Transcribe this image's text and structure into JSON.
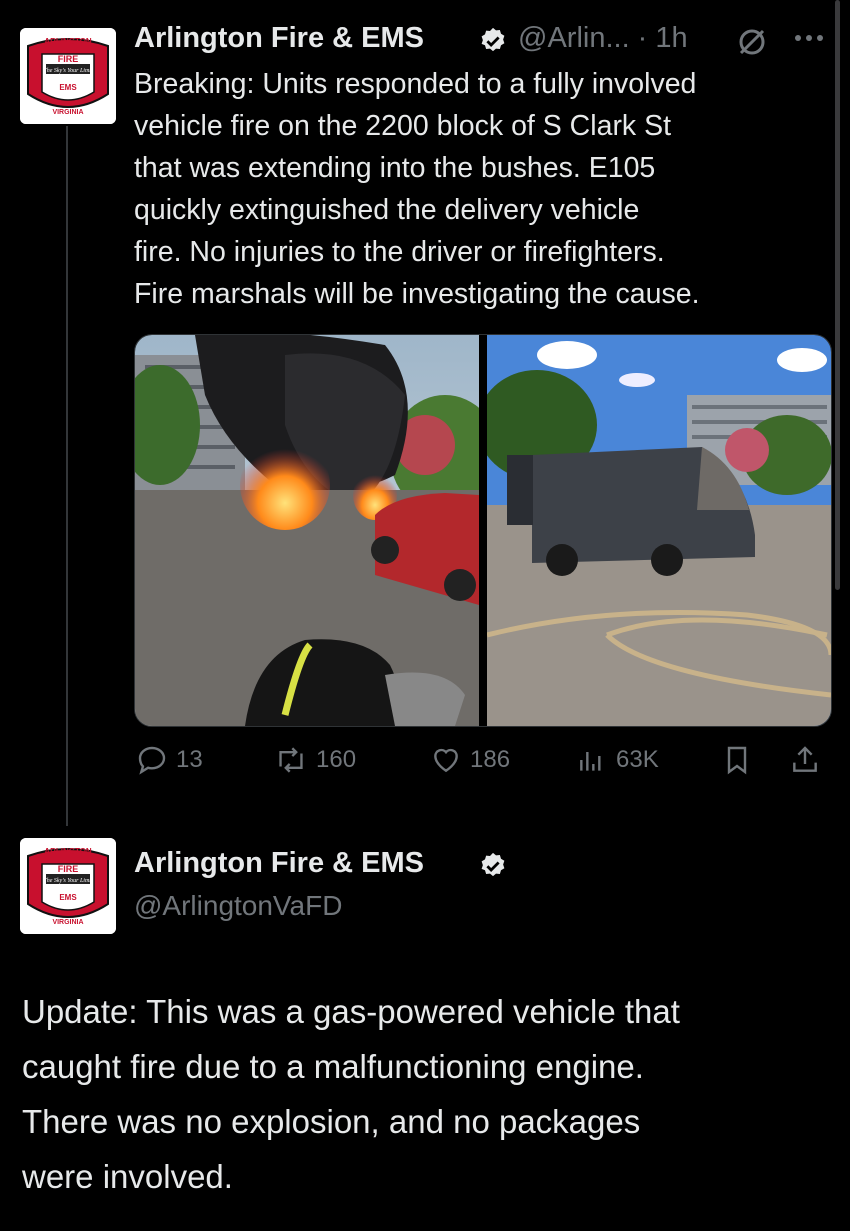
{
  "tweet1": {
    "author": "Arlington Fire & EMS",
    "handle_time": "@Arlin... · 1h",
    "text_lines": [
      "Breaking: Units responded to a fully involved",
      "vehicle fire on the 2200 block of S Clark St",
      "that was extending into the bushes. E105",
      "quickly extinguished the delivery vehicle",
      "fire. No injuries to the driver or firefighters.",
      "Fire marshals will be investigating the cause."
    ],
    "stats": {
      "replies": "13",
      "reposts": "160",
      "likes": "186",
      "views": "63K"
    }
  },
  "tweet2": {
    "author": "Arlington Fire & EMS",
    "handle": "@ArlingtonVaFD",
    "text_lines": [
      "Update: This was a gas-powered vehicle that",
      "caught fire due to a malfunctioning engine.",
      "There was no explosion, and no packages",
      "were involved."
    ]
  },
  "logo": {
    "top_text": "ARLINGTON",
    "bottom_text": "VIRGINIA",
    "fire": "FIRE",
    "ems": "EMS",
    "motto": "The Sky's Your Limit"
  },
  "colors": {
    "background": "#000000",
    "text": "#e7e9ea",
    "muted": "#71767b",
    "verified": "#e7e9ea",
    "badge_red": "#c8102e"
  },
  "icons": {
    "verified": "verified-badge-icon",
    "grok": "grok-icon",
    "more": "more-icon",
    "reply": "reply-icon",
    "repost": "repost-icon",
    "like": "heart-icon",
    "views": "views-icon",
    "bookmark": "bookmark-icon",
    "share": "share-icon"
  }
}
